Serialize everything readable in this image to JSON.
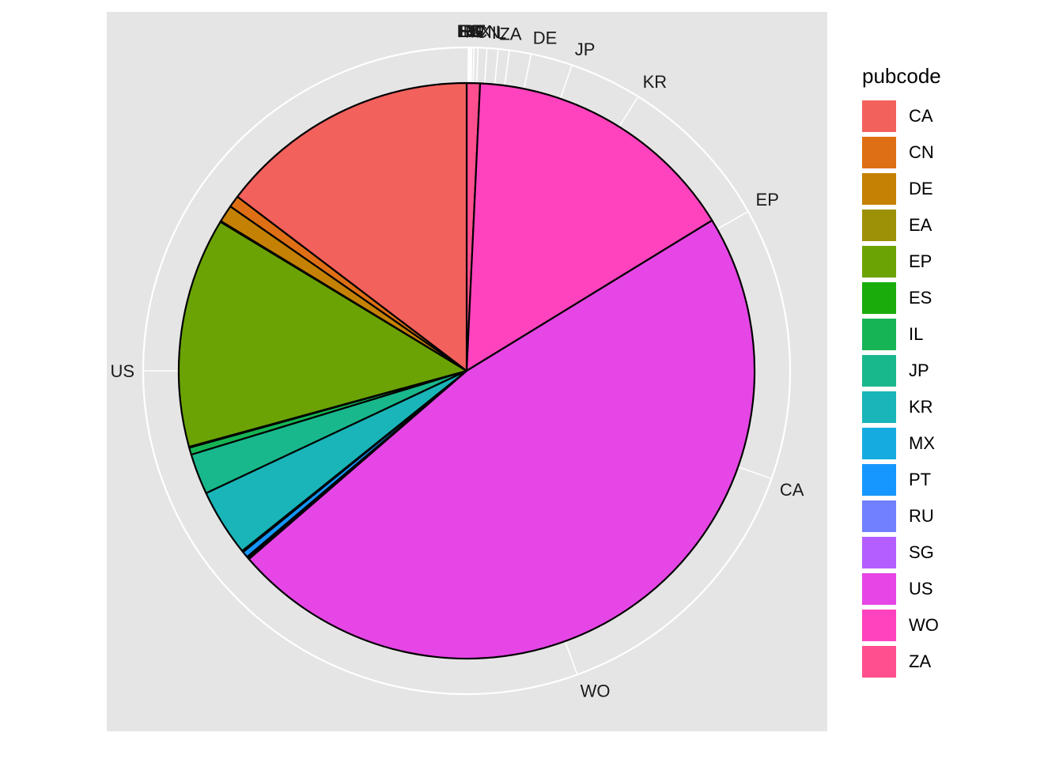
{
  "chart_data": {
    "type": "pie",
    "title": "",
    "legend_title": "pubcode",
    "legend_position": "right",
    "direction": "clockwise",
    "start": "top",
    "slices_clockwise_from_top": [
      {
        "label": "ZA",
        "value": 0.75,
        "color": "#FF4F8F"
      },
      {
        "label": "WO",
        "value": 15.6,
        "color": "#FF43BF"
      },
      {
        "label": "US",
        "value": 47.7,
        "color": "#E646E6"
      },
      {
        "label": "SG",
        "value": 0.08,
        "color": "#B45EFF"
      },
      {
        "label": "RU",
        "value": 0.08,
        "color": "#7080FF"
      },
      {
        "label": "PT",
        "value": 0.35,
        "color": "#1597FF"
      },
      {
        "label": "MX",
        "value": 0.08,
        "color": "#16ABE0"
      },
      {
        "label": "KR",
        "value": 3.8,
        "color": "#19B5B8"
      },
      {
        "label": "JP",
        "value": 2.3,
        "color": "#19B88C"
      },
      {
        "label": "IL",
        "value": 0.4,
        "color": "#17B455"
      },
      {
        "label": "ES",
        "value": 0.05,
        "color": "#1AAC0B"
      },
      {
        "label": "EP",
        "value": 13.0,
        "color": "#6BA304"
      },
      {
        "label": "EA",
        "value": 0.05,
        "color": "#9D9207"
      },
      {
        "label": "DE",
        "value": 0.97,
        "color": "#C58104"
      },
      {
        "label": "CN",
        "value": 0.67,
        "color": "#DE6F14"
      },
      {
        "label": "CA",
        "value": 14.75,
        "color": "#F3615D"
      }
    ],
    "legend": [
      {
        "label": "CA",
        "color": "#F3615D"
      },
      {
        "label": "CN",
        "color": "#DE6F14"
      },
      {
        "label": "DE",
        "color": "#C58104"
      },
      {
        "label": "EA",
        "color": "#9D9207"
      },
      {
        "label": "EP",
        "color": "#6BA304"
      },
      {
        "label": "ES",
        "color": "#1AAC0B"
      },
      {
        "label": "IL",
        "color": "#17B455"
      },
      {
        "label": "JP",
        "color": "#19B88C"
      },
      {
        "label": "KR",
        "color": "#19B5B8"
      },
      {
        "label": "MX",
        "color": "#16ABE0"
      },
      {
        "label": "PT",
        "color": "#1597FF"
      },
      {
        "label": "RU",
        "color": "#7080FF"
      },
      {
        "label": "SG",
        "color": "#B45EFF"
      },
      {
        "label": "US",
        "color": "#E646E6"
      },
      {
        "label": "WO",
        "color": "#FF43BF"
      },
      {
        "label": "ZA",
        "color": "#FF4F8F"
      }
    ],
    "theta_axis_labels": [
      {
        "label": "ES",
        "angle_deg": 0.3
      },
      {
        "label": "EA",
        "angle_deg": 0.5
      },
      {
        "label": "SG",
        "angle_deg": 0.7
      },
      {
        "label": "RU",
        "angle_deg": 0.9
      },
      {
        "label": "PT",
        "angle_deg": 1.3
      },
      {
        "label": "MX",
        "angle_deg": 2.0
      },
      {
        "label": "CN",
        "angle_deg": 3.6
      },
      {
        "label": "IL",
        "angle_deg": 5.6
      },
      {
        "label": "ZA",
        "angle_deg": 7.6
      },
      {
        "label": "DE",
        "angle_deg": 11.5
      },
      {
        "label": "JP",
        "angle_deg": 19.0
      },
      {
        "label": "KR",
        "angle_deg": 32.0
      },
      {
        "label": "EP",
        "angle_deg": 60.5
      },
      {
        "label": "CA",
        "angle_deg": 109.5
      },
      {
        "label": "WO",
        "angle_deg": 160.0
      },
      {
        "label": "US",
        "angle_deg": 270.0
      }
    ],
    "grid": true
  }
}
